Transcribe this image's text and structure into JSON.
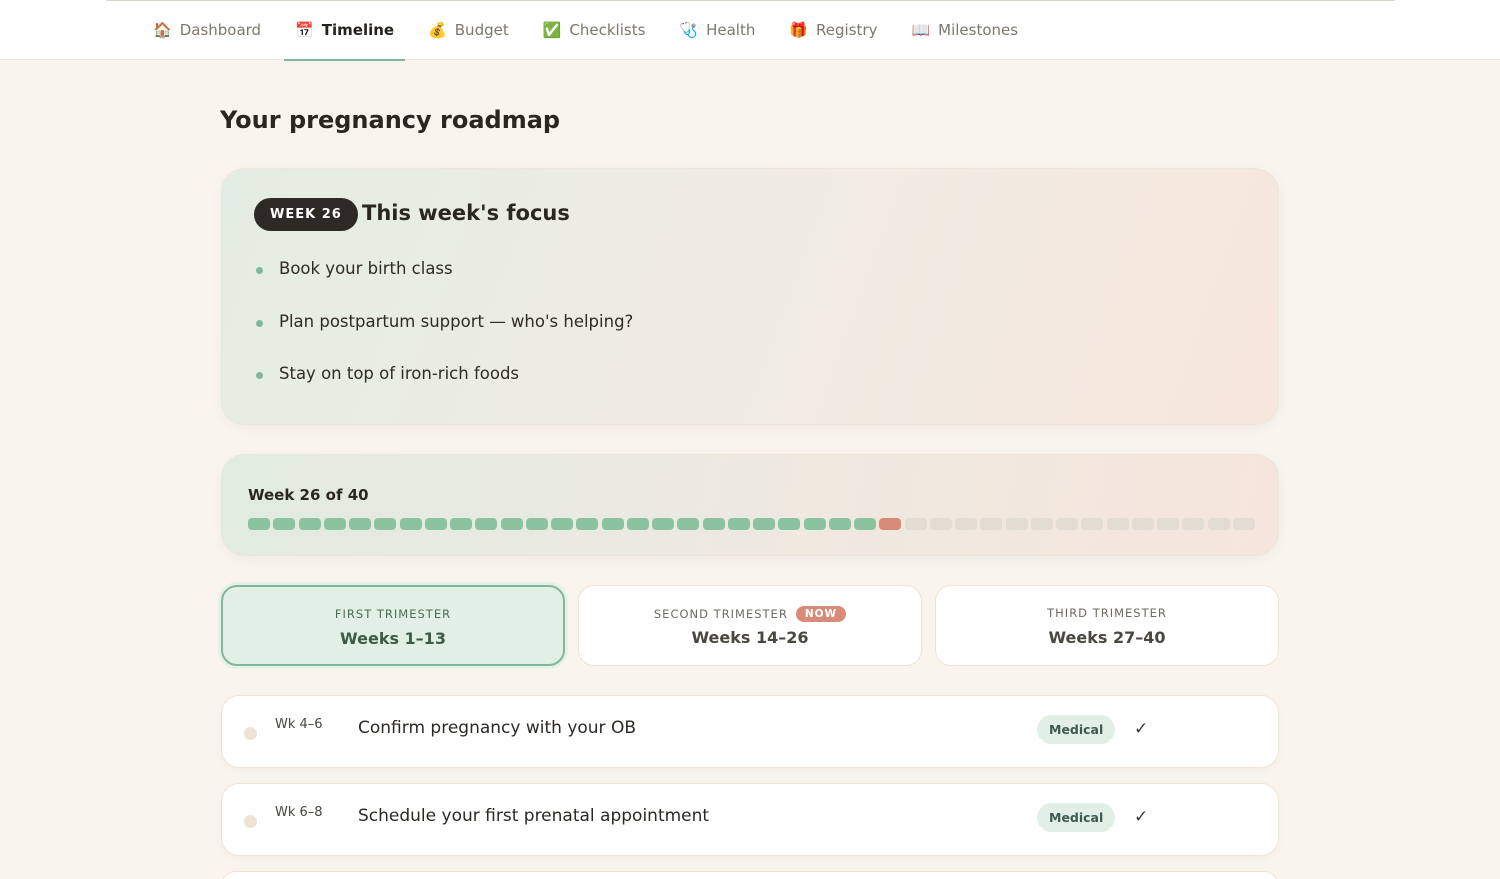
{
  "nav": {
    "tabs": [
      {
        "icon": "🏠",
        "label": "Dashboard",
        "active": false
      },
      {
        "icon": "📅",
        "label": "Timeline",
        "active": true
      },
      {
        "icon": "💰",
        "label": "Budget",
        "active": false
      },
      {
        "icon": "✅",
        "label": "Checklists",
        "active": false
      },
      {
        "icon": "🩺",
        "label": "Health",
        "active": false
      },
      {
        "icon": "🎁",
        "label": "Registry",
        "active": false
      },
      {
        "icon": "📖",
        "label": "Milestones",
        "active": false
      }
    ]
  },
  "page": {
    "title": "Your pregnancy roadmap"
  },
  "focus": {
    "week_label": "WEEK 26",
    "title": "This week's focus",
    "items": [
      "Book your birth class",
      "Plan postpartum support — who's helping?",
      "Stay on top of iron-rich foods"
    ]
  },
  "progress": {
    "label": "Week 26 of 40",
    "current_week": 26,
    "total_weeks": 40,
    "colors": {
      "done": "#8bc3a0",
      "current": "#d98b7a",
      "upcoming": "#e3dcd2"
    }
  },
  "trimesters": [
    {
      "name": "FIRST TRIMESTER",
      "weeks": "Weeks 1–13",
      "selected": true,
      "badge": ""
    },
    {
      "name": "SECOND TRIMESTER",
      "weeks": "Weeks 14–26",
      "selected": false,
      "badge": "NOW"
    },
    {
      "name": "THIRD TRIMESTER",
      "weeks": "Weeks 27–40",
      "selected": false,
      "badge": ""
    }
  ],
  "tasks": [
    {
      "weeks": "Wk 4–6",
      "title": "Confirm pregnancy with your OB",
      "tag": "Medical",
      "check": "✓"
    },
    {
      "weeks": "Wk 6–8",
      "title": "Schedule your first prenatal appointment",
      "tag": "Medical",
      "check": "✓"
    }
  ]
}
